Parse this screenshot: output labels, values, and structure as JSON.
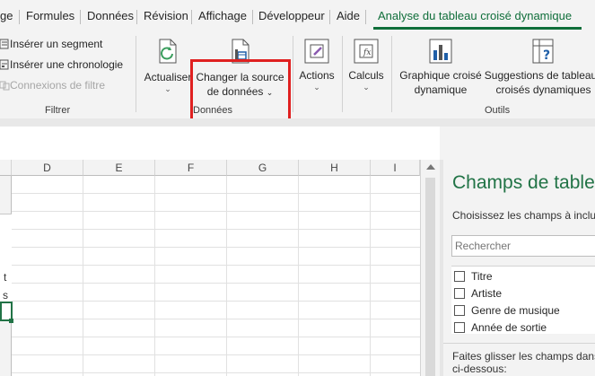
{
  "tabs": {
    "items": [
      "Formules",
      "Données",
      "Révision",
      "Affichage",
      "Développeur",
      "Aide"
    ],
    "active": "Analyse du tableau croisé dynamique",
    "leading_fragment": "ge"
  },
  "ribbon": {
    "filtrer": {
      "insert_slicer": "Insérer un segment",
      "insert_timeline": "Insérer une chronologie",
      "filter_connections": "Connexions de filtre",
      "group_label": "Filtrer"
    },
    "donnees": {
      "refresh": "Actualiser",
      "change_source_line1": "Changer la source",
      "change_source_line2": "de données",
      "group_label": "Données"
    },
    "actions": {
      "label": "Actions"
    },
    "calculs": {
      "label": "Calculs"
    },
    "outils": {
      "pivot_chart_line1": "Graphique croisé",
      "pivot_chart_line2": "dynamique",
      "suggestions_line1": "Suggestions de tableaux",
      "suggestions_line2": "croisés dynamiques",
      "group_label": "Outils"
    }
  },
  "sheet": {
    "columns": [
      "D",
      "E",
      "F",
      "G",
      "H",
      "I"
    ],
    "left_fragments": [
      "t",
      "s"
    ]
  },
  "pane": {
    "title": "Champs de tableau",
    "subtitle": "Choisissez les champs à inclure",
    "search_placeholder": "Rechercher",
    "fields": [
      "Titre",
      "Artiste",
      "Genre de musique",
      "Année de sortie"
    ],
    "drag_text_line1": "Faites glisser les champs dans",
    "drag_text_line2": "ci-dessous:"
  },
  "colors": {
    "accent": "#217346",
    "active_tab": "#0f6e3a",
    "highlight": "#e02020"
  }
}
